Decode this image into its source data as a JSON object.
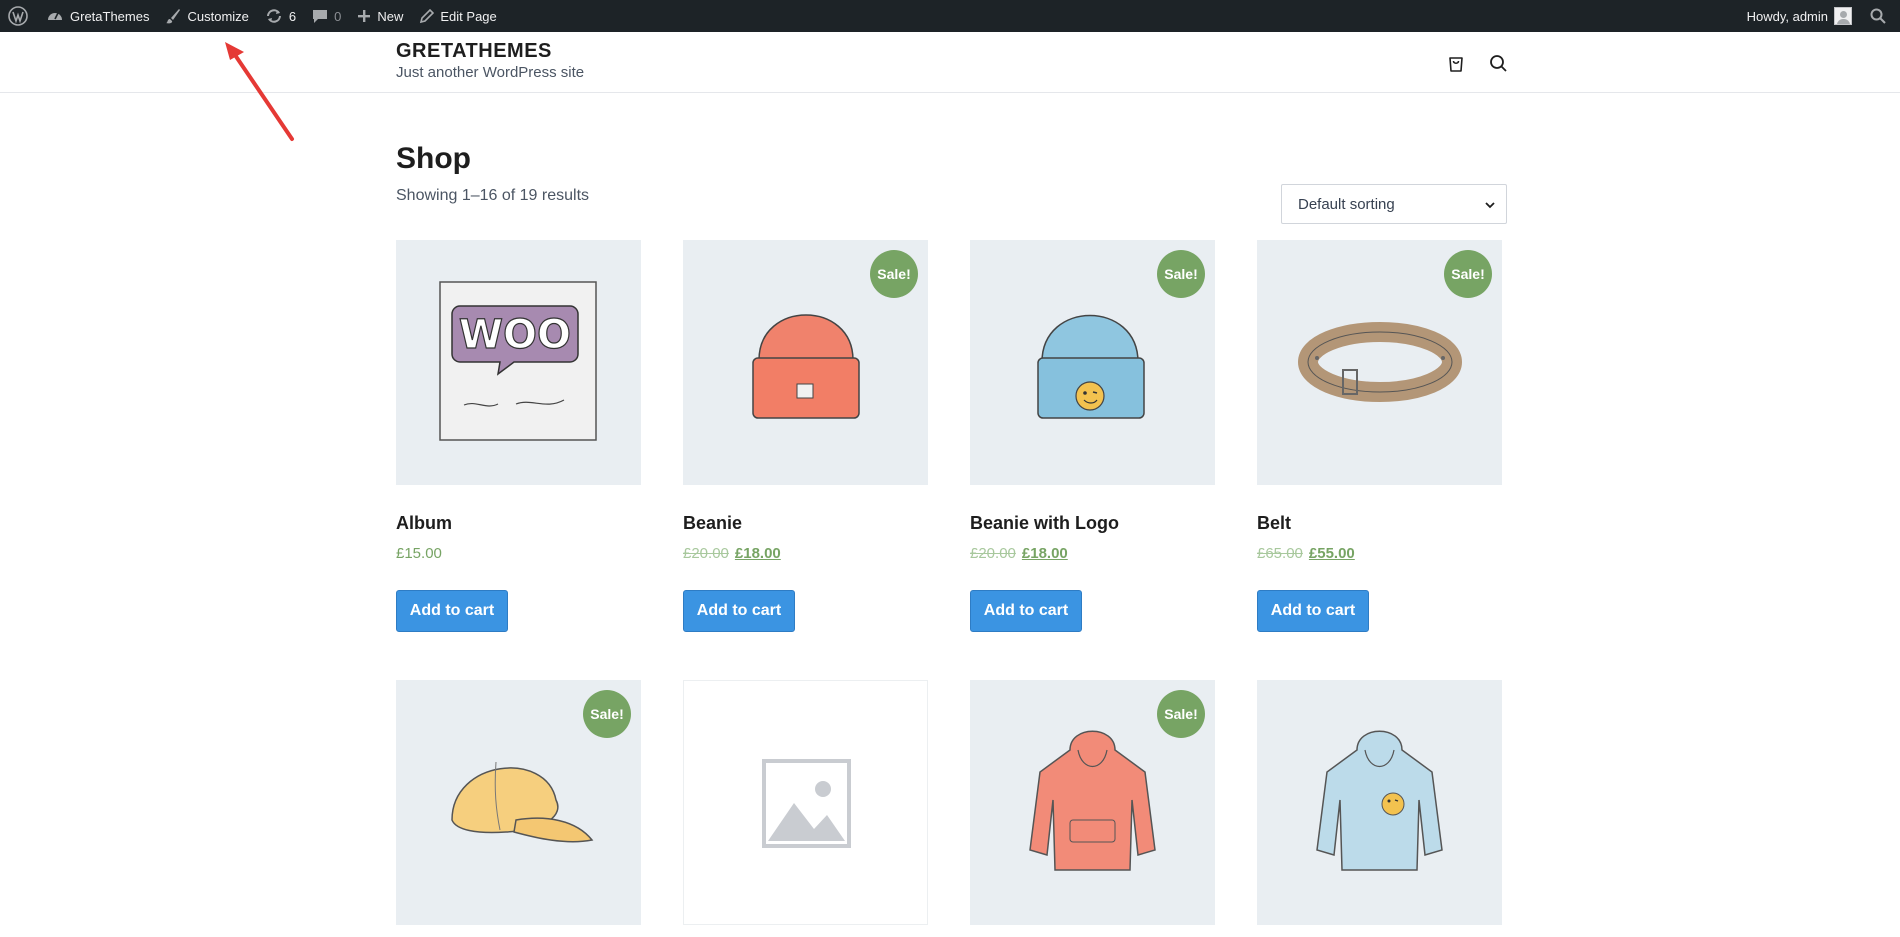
{
  "adminbar": {
    "site_name": "GretaThemes",
    "customize": "Customize",
    "updates_count": "6",
    "comments_count": "0",
    "new_label": "New",
    "edit_page": "Edit Page",
    "howdy": "Howdy, admin"
  },
  "header": {
    "site_title": "GRETATHEMES",
    "tagline": "Just another WordPress site",
    "cart_icon": "cart-icon",
    "search_icon": "search-icon"
  },
  "shop": {
    "title": "Shop",
    "result_count": "Showing 1–16 of 19 results",
    "sorting_selected": "Default sorting",
    "sale_badge": "Sale!",
    "add_to_cart": "Add to cart",
    "products": [
      {
        "name": "Album",
        "price": "£15.00",
        "old_price": "",
        "new_price": "",
        "on_sale": false,
        "image": "woo-album"
      },
      {
        "name": "Beanie",
        "price": "",
        "old_price": "£20.00",
        "new_price": "£18.00",
        "on_sale": true,
        "image": "orange-beanie"
      },
      {
        "name": "Beanie with Logo",
        "price": "",
        "old_price": "£20.00",
        "new_price": "£18.00",
        "on_sale": true,
        "image": "blue-beanie-logo"
      },
      {
        "name": "Belt",
        "price": "",
        "old_price": "£65.00",
        "new_price": "£55.00",
        "on_sale": true,
        "image": "leather-belt"
      },
      {
        "on_sale": true,
        "image": "yellow-cap"
      },
      {
        "on_sale": false,
        "image": "placeholder"
      },
      {
        "on_sale": true,
        "image": "red-hoodie"
      },
      {
        "on_sale": false,
        "image": "blue-hoodie-logo"
      }
    ]
  },
  "colors": {
    "adminbar_bg": "#1d2327",
    "button_blue": "#3b94e2",
    "sale_green": "#77a464",
    "image_bg": "#e9eef2",
    "annotation_arrow": "#e53935"
  }
}
